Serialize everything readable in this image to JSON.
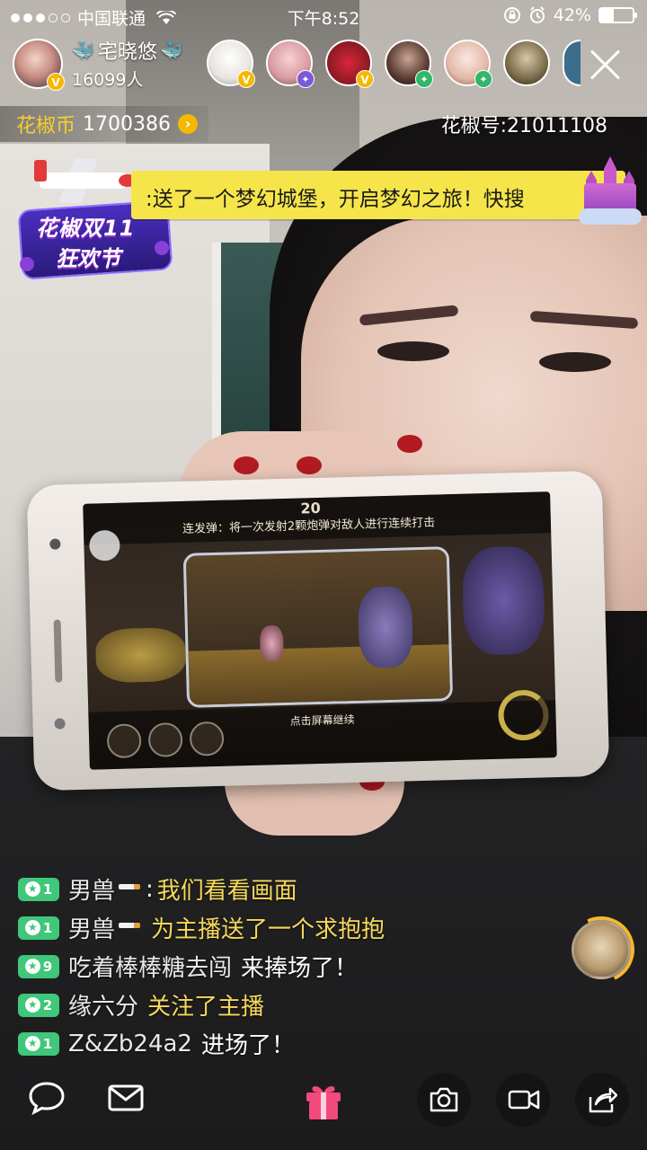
{
  "status_bar": {
    "carrier": "中国联通",
    "time": "下午8:52",
    "battery_percent": "42%",
    "battery_level": 0.42
  },
  "host": {
    "name": "宅晓悠",
    "viewer_count": "16099人",
    "badge": "V"
  },
  "viewers": [
    {
      "badge": "V"
    },
    {
      "badge": "✦"
    },
    {
      "badge": "V"
    },
    {
      "badge": "✦"
    },
    {
      "badge": "✦"
    },
    {
      "badge": ""
    },
    {
      "badge": ""
    }
  ],
  "coins": {
    "label": "花椒币",
    "value": "1700386"
  },
  "room_id": "花椒号:21011108",
  "gift_banner": {
    "text": ":送了一个梦幻城堡，开启梦幻之旅！快搜",
    "festival_line1": "花椒双11",
    "festival_line2": "狂欢节"
  },
  "game_screen": {
    "timer": "20",
    "hint": "连发弹：将一次发射2颗炮弹对敌人进行连续打击",
    "cta": "点击屏幕继续"
  },
  "chat": [
    {
      "level": "1",
      "user": "男兽",
      "has_cig": true,
      "sep": ":",
      "message": "我们看看画面",
      "message_color": "white"
    },
    {
      "level": "1",
      "user": "男兽",
      "has_cig": true,
      "sep": "",
      "message": "为主播送了一个求抱抱",
      "message_color": "yellow"
    },
    {
      "level": "9",
      "user": "吃着棒棒糖去闯",
      "has_cig": false,
      "sep": "",
      "message": "来捧场了！",
      "message_color": "white"
    },
    {
      "level": "2",
      "user": "缘六分",
      "has_cig": false,
      "sep": "",
      "message": "关注了主播",
      "message_color": "yellow"
    },
    {
      "level": "1",
      "user": "Z&Zb24a2",
      "has_cig": false,
      "sep": "",
      "message": "进场了！",
      "message_color": "white"
    }
  ],
  "toolbar": {
    "icons": [
      "chat-bubble-icon",
      "mail-icon",
      "gift-icon",
      "camera-icon",
      "video-icon",
      "share-icon"
    ]
  },
  "colors": {
    "banner_yellow": "#f6e54a",
    "level_green": "#3fc77a",
    "coin_gold": "#f6d02a",
    "gift_pink": "#f24a7a"
  }
}
